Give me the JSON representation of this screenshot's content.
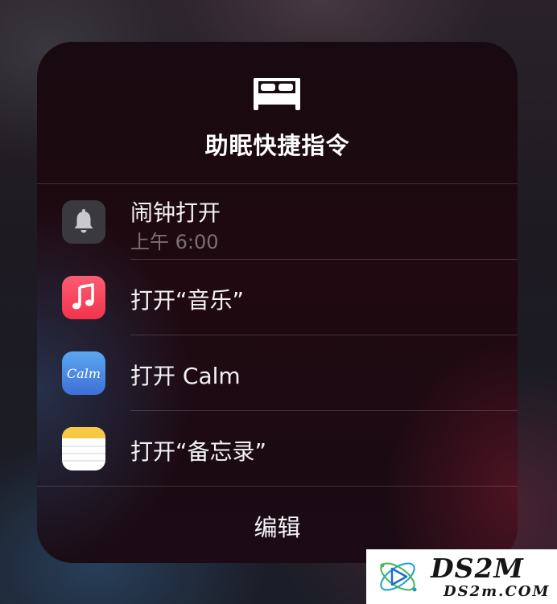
{
  "panel": {
    "icon": "bed-icon",
    "title": "助眠快捷指令"
  },
  "shortcuts": [
    {
      "icon": "bell-icon",
      "label": "闹钟打开",
      "sublabel": "上午 6:00",
      "icon_bg": "#3a3a3e"
    },
    {
      "icon": "music-icon",
      "label": "打开“音乐”",
      "icon_bg": "#f2344b"
    },
    {
      "icon": "calm-icon",
      "label": "打开 Calm",
      "icon_text": "Calm",
      "icon_bg": "#3f7fe0"
    },
    {
      "icon": "notes-icon",
      "label": "打开“备忘录”",
      "icon_bg": "#ffffff"
    }
  ],
  "footer": {
    "edit_label": "编辑"
  },
  "watermark": {
    "main": "DS2M",
    "sub": "DS2m.COM"
  }
}
